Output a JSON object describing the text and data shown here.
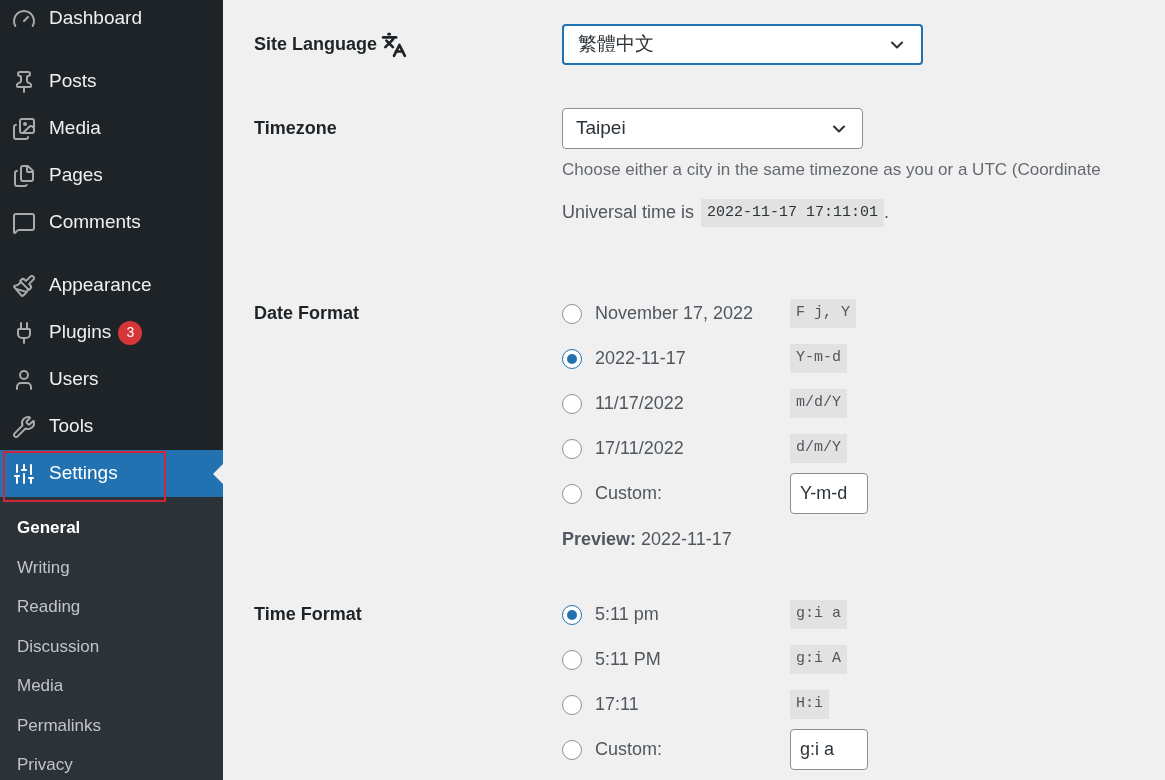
{
  "sidebar": {
    "groups": [
      {
        "items": [
          {
            "label": "Dashboard",
            "selected": false
          }
        ]
      },
      {
        "items": [
          {
            "label": "Posts",
            "selected": false
          },
          {
            "label": "Media",
            "selected": false
          },
          {
            "label": "Pages",
            "selected": false
          },
          {
            "label": "Comments",
            "selected": false
          }
        ]
      },
      {
        "items": [
          {
            "label": "Appearance",
            "selected": false
          },
          {
            "label": "Plugins",
            "selected": false,
            "badge": "3"
          },
          {
            "label": "Users",
            "selected": false
          },
          {
            "label": "Tools",
            "selected": false
          },
          {
            "label": "Settings",
            "selected": true,
            "annotated": true
          }
        ]
      }
    ],
    "submenu": [
      {
        "label": "General",
        "selected": true
      },
      {
        "label": "Writing",
        "selected": false
      },
      {
        "label": "Reading",
        "selected": false
      },
      {
        "label": "Discussion",
        "selected": false
      },
      {
        "label": "Media",
        "selected": false
      },
      {
        "label": "Permalinks",
        "selected": false
      },
      {
        "label": "Privacy",
        "selected": false
      }
    ]
  },
  "site_language": {
    "label": "Site Language",
    "value": "繁體中文",
    "focused": true
  },
  "timezone": {
    "label": "Timezone",
    "value": "Taipei",
    "description": "Choose either a city in the same timezone as you or a UTC (Coordinate",
    "universal_prefix": "Universal time is",
    "universal_time": "2022-11-17 17:11:01",
    "universal_suffix": "."
  },
  "date_format": {
    "label": "Date Format",
    "options": [
      {
        "label": "November 17, 2022",
        "code": "F j, Y",
        "selected": false,
        "kind": "preset"
      },
      {
        "label": "2022-11-17",
        "code": "Y-m-d",
        "selected": true,
        "kind": "preset"
      },
      {
        "label": "11/17/2022",
        "code": "m/d/Y",
        "selected": false,
        "kind": "preset"
      },
      {
        "label": "17/11/2022",
        "code": "d/m/Y",
        "selected": false,
        "kind": "preset"
      },
      {
        "label": "Custom:",
        "code": "Y-m-d",
        "selected": false,
        "kind": "custom"
      }
    ],
    "preview": "**Preview:** 2022-11-17"
  },
  "time_format": {
    "label": "Time Format",
    "options": [
      {
        "label": "5:11 pm",
        "code": "g:i a",
        "selected": true,
        "kind": "preset"
      },
      {
        "label": "5:11 PM",
        "code": "g:i A",
        "selected": false,
        "kind": "preset"
      },
      {
        "label": "17:11",
        "code": "H:i",
        "selected": false,
        "kind": "preset"
      },
      {
        "label": "Custom:",
        "code": "g:i a",
        "selected": false,
        "kind": "custom"
      }
    ]
  }
}
